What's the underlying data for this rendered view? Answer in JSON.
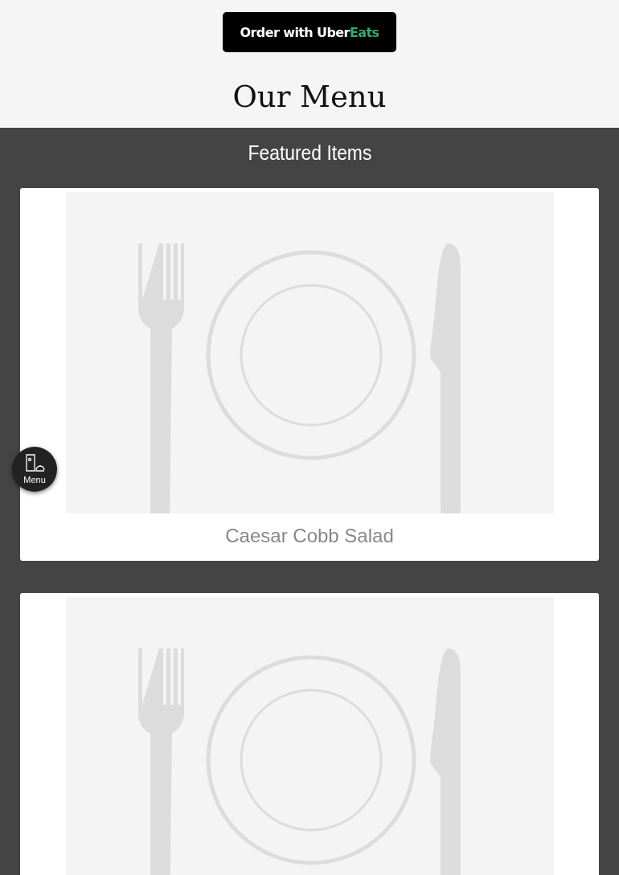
{
  "order_button": {
    "label": "Order with Uber",
    "accent": "Eats"
  },
  "page_title": "Our Menu",
  "featured": {
    "heading": "Featured Items",
    "items": [
      {
        "kind": "placeholder-photo",
        "name": "Caesar Cobb Salad"
      },
      {
        "kind": "placeholder-photo"
      }
    ]
  },
  "menu_fab": {
    "label": "Menu"
  }
}
